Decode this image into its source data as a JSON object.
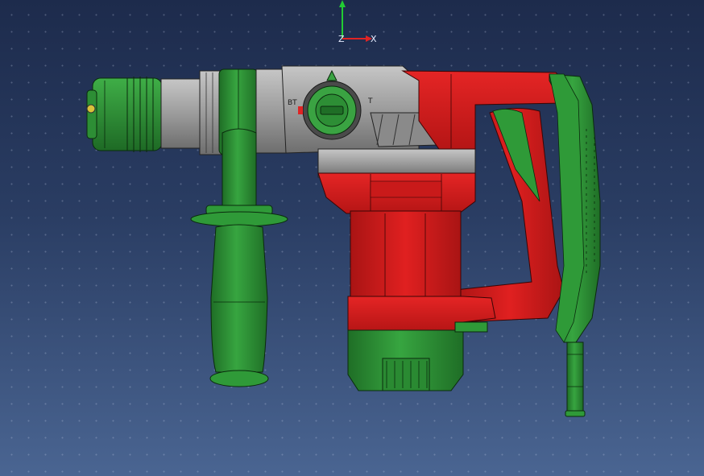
{
  "viewer": {
    "colors": {
      "background_top": "#1d2b4c",
      "background_bottom": "#4a6592",
      "body_red": "#d81e1e",
      "body_red_dark": "#a31212",
      "grip_green": "#2e9436",
      "grip_green_dark": "#1d6a24",
      "metal_gray": "#9a9a9a",
      "axis_z": "#22cc33",
      "axis_x": "#e02424"
    },
    "axis_triad": {
      "z_label": "Z",
      "x_label": "X"
    },
    "selector_knob": {
      "left_mark": "BT",
      "right_mark": "T"
    },
    "icons": [
      "axis-triad-icon"
    ]
  }
}
